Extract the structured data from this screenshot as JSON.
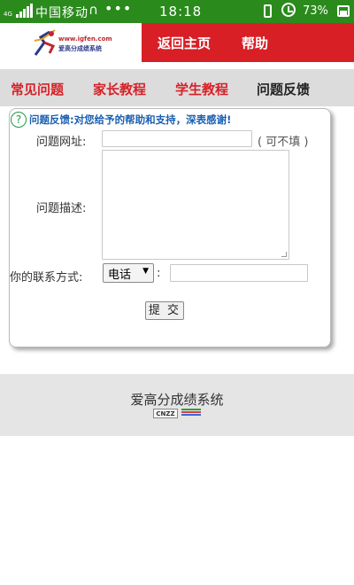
{
  "status_bar": {
    "network_label": "4G",
    "carrier": "中国移动",
    "more_dots": "•••",
    "time": "18:18",
    "battery_percent": "73%",
    "icons": [
      "signal-icon",
      "headset-hook-icon",
      "vibrate-icon",
      "alarm-icon",
      "battery-icon"
    ]
  },
  "header": {
    "logo_url_text": "www.igfen.com",
    "logo_name_text": "爱高分成绩系统",
    "nav": [
      "返回主页",
      "帮助"
    ],
    "bg_color": "#d81f26"
  },
  "tabs": {
    "items": [
      "常见问题",
      "家长教程",
      "学生教程",
      "问题反馈"
    ],
    "active": "问题反馈",
    "text_color": "#d81f26"
  },
  "form": {
    "intro": "问题反馈:对您给予的帮助和支持，深表感谢!",
    "url_label": "问题网址:",
    "url_value": "",
    "optional_note": "( 可不填 )",
    "description_label": "问题描述:",
    "description_value": "",
    "contact_label": "你的联系方式:",
    "contact_type_selected": "电话",
    "contact_value": "",
    "colon": ":",
    "submit_label": "提 交"
  },
  "footer": {
    "title": "爱高分成绩系统",
    "badge": "CNZZ"
  }
}
